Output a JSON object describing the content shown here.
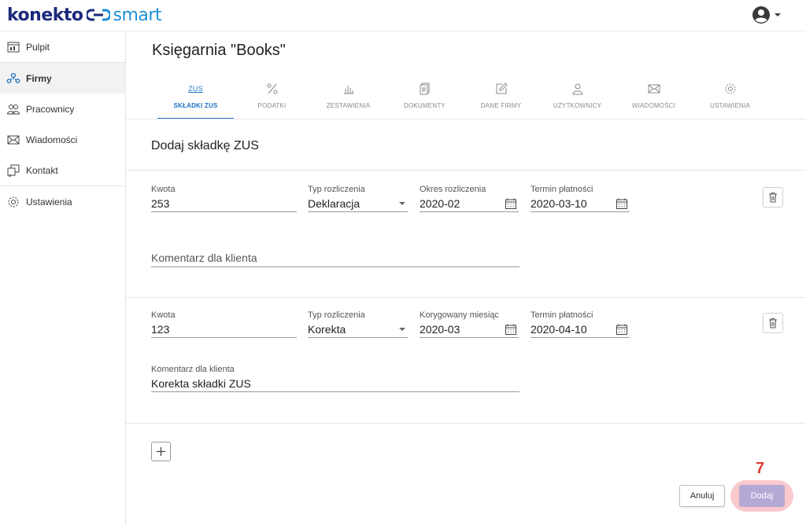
{
  "app": {
    "logo_left": "konekto",
    "logo_right": "smart"
  },
  "colors": {
    "accent": "#1f72c4",
    "logo_dark": "#1b2a7a",
    "logo_light": "#1e8fd6",
    "primary_button": "#b3a9d4",
    "highlight": "#f9c9cd",
    "marker": "#e03c31"
  },
  "user_menu": {
    "icon": "account-circle-icon"
  },
  "sidebar": {
    "items": [
      {
        "label": "Pulpit",
        "icon": "dashboard-icon",
        "active": false
      },
      {
        "label": "Firmy",
        "icon": "company-icon",
        "active": true
      },
      {
        "label": "Pracownicy",
        "icon": "employees-icon",
        "active": false
      },
      {
        "label": "Wiadomości",
        "icon": "mail-icon",
        "active": false
      },
      {
        "label": "Kontakt",
        "icon": "contact-icon",
        "active": false
      },
      {
        "label": "Ustawienia",
        "icon": "gear-icon",
        "active": false
      }
    ]
  },
  "main": {
    "company_name": "Księgarnia \"Books\"",
    "tabs": [
      {
        "label": "SKŁADKI ZUS",
        "icon": "zus-icon",
        "active": true,
        "icon_text": "ZUS"
      },
      {
        "label": "PODATKI",
        "icon": "percent-icon",
        "active": false
      },
      {
        "label": "ZESTAWIENIA",
        "icon": "bar-chart-icon",
        "active": false
      },
      {
        "label": "DOKUMENTY",
        "icon": "documents-icon",
        "active": false
      },
      {
        "label": "DANE FIRMY",
        "icon": "edit-icon",
        "active": false
      },
      {
        "label": "UŻYTKOWNICY",
        "icon": "user-icon",
        "active": false
      },
      {
        "label": "WIADOMOŚCI",
        "icon": "mail-icon",
        "active": false
      },
      {
        "label": "USTAWIENIA",
        "icon": "gear-icon",
        "active": false
      }
    ],
    "section_title": "Dodaj składkę ZUS",
    "entries": [
      {
        "amount_label": "Kwota",
        "amount": "253",
        "type_label": "Typ rozliczenia",
        "type": "Deklaracja",
        "period_label": "Okres rozliczenia",
        "period": "2020-02",
        "due_label": "Termin płatności",
        "due": "2020-03-10",
        "comment_label": "Komentarz dla klienta",
        "comment": ""
      },
      {
        "amount_label": "Kwota",
        "amount": "123",
        "type_label": "Typ rozliczenia",
        "type": "Korekta",
        "period_label": "Korygowany miesiąc",
        "period": "2020-03",
        "due_label": "Termin płatności",
        "due": "2020-04-10",
        "comment_label": "Komentarz dla klienta",
        "comment": "Korekta składki ZUS"
      }
    ],
    "add_row_label": "+",
    "cancel_label": "Anuluj",
    "submit_label": "Dodaj",
    "step_marker": "7"
  }
}
